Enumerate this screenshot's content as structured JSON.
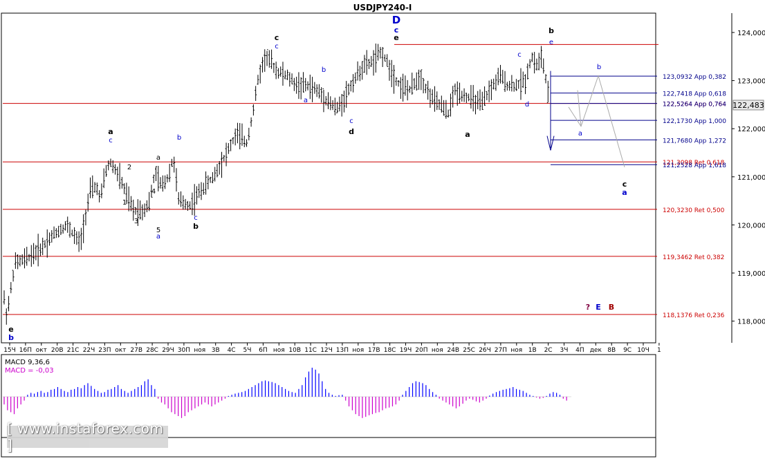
{
  "chart_data": {
    "type": "candlestick",
    "title": "USDJPY240-I",
    "current_price": "122,483",
    "ylim": [
      117.5,
      124.4
    ],
    "y_ticks": [
      "124,000",
      "123,000",
      "122,000",
      "121,000",
      "120,000",
      "119,000",
      "118,000"
    ],
    "y_tick_values": [
      124.0,
      123.0,
      122.0,
      121.0,
      120.0,
      119.0,
      118.0
    ],
    "x_ticks": [
      "15Ч",
      "16П",
      "окт",
      "20В",
      "21С",
      "22Ч",
      "23П",
      "окт",
      "27В",
      "28С",
      "29Ч",
      "30П",
      "ноя",
      "3В",
      "4С",
      "5Ч",
      "6П",
      "ноя",
      "10В",
      "11С",
      "12Ч",
      "13П",
      "ноя",
      "17В",
      "18С",
      "19Ч",
      "20П",
      "ноя",
      "24В",
      "25С",
      "26Ч",
      "27П",
      "ноя",
      "1В",
      "2С",
      "3Ч",
      "4П",
      "дек",
      "8В",
      "9С",
      "10Ч",
      "1"
    ],
    "candle_path_points": [
      [
        0,
        119.0
      ],
      [
        10,
        118.1
      ],
      [
        22,
        119.2
      ],
      [
        40,
        119.3
      ],
      [
        60,
        119.5
      ],
      [
        80,
        119.8
      ],
      [
        100,
        120.0
      ],
      [
        120,
        119.6
      ],
      [
        135,
        120.7
      ],
      [
        145,
        120.8
      ],
      [
        150,
        120.5
      ],
      [
        158,
        121.1
      ],
      [
        165,
        121.3
      ],
      [
        175,
        121.1
      ],
      [
        182,
        120.9
      ],
      [
        190,
        120.6
      ],
      [
        200,
        120.3
      ],
      [
        215,
        120.3
      ],
      [
        225,
        120.5
      ],
      [
        232,
        121.1
      ],
      [
        242,
        120.8
      ],
      [
        252,
        121.0
      ],
      [
        260,
        121.4
      ],
      [
        268,
        120.5
      ],
      [
        285,
        120.4
      ],
      [
        300,
        120.7
      ],
      [
        320,
        121.0
      ],
      [
        340,
        121.5
      ],
      [
        355,
        121.9
      ],
      [
        370,
        121.7
      ],
      [
        380,
        122.4
      ],
      [
        388,
        123.1
      ],
      [
        398,
        123.5
      ],
      [
        406,
        123.4
      ],
      [
        415,
        123.2
      ],
      [
        430,
        123.1
      ],
      [
        445,
        122.9
      ],
      [
        460,
        122.9
      ],
      [
        475,
        122.8
      ],
      [
        490,
        122.6
      ],
      [
        505,
        122.4
      ],
      [
        515,
        122.6
      ],
      [
        530,
        123.0
      ],
      [
        545,
        123.3
      ],
      [
        560,
        123.4
      ],
      [
        572,
        123.6
      ],
      [
        580,
        123.4
      ],
      [
        590,
        123.1
      ],
      [
        600,
        122.9
      ],
      [
        615,
        122.8
      ],
      [
        630,
        123.1
      ],
      [
        640,
        122.8
      ],
      [
        650,
        122.6
      ],
      [
        660,
        122.5
      ],
      [
        672,
        122.3
      ],
      [
        682,
        122.8
      ],
      [
        695,
        122.7
      ],
      [
        710,
        122.6
      ],
      [
        722,
        122.5
      ],
      [
        735,
        122.8
      ],
      [
        750,
        123.1
      ],
      [
        762,
        122.9
      ],
      [
        775,
        122.9
      ],
      [
        788,
        123.0
      ],
      [
        797,
        123.5
      ],
      [
        806,
        123.3
      ],
      [
        812,
        123.5
      ],
      [
        818,
        123.1
      ],
      [
        824,
        122.5
      ]
    ],
    "macd_label": "MACD 9,36,6",
    "macd_value_label": "MACD = -0,03",
    "macd_values": [
      -0.02,
      -0.035,
      -0.04,
      -0.045,
      -0.03,
      -0.02,
      -0.01,
      0.005,
      0.01,
      0.008,
      0.012,
      0.015,
      0.01,
      0.012,
      0.018,
      0.02,
      0.025,
      0.02,
      0.015,
      0.012,
      0.018,
      0.02,
      0.025,
      0.022,
      0.03,
      0.035,
      0.028,
      0.02,
      0.015,
      0.01,
      0.012,
      0.018,
      0.02,
      0.025,
      0.03,
      0.02,
      0.015,
      0.01,
      0.015,
      0.02,
      0.025,
      0.03,
      0.04,
      0.045,
      0.03,
      0.02,
      -0.005,
      -0.015,
      -0.02,
      -0.03,
      -0.04,
      -0.045,
      -0.05,
      -0.055,
      -0.05,
      -0.04,
      -0.035,
      -0.03,
      -0.025,
      -0.02,
      -0.015,
      -0.02,
      -0.025,
      -0.02,
      -0.015,
      -0.01,
      -0.005,
      0.002,
      0.005,
      0.008,
      0.01,
      0.012,
      0.015,
      0.02,
      0.025,
      0.03,
      0.035,
      0.04,
      0.042,
      0.04,
      0.038,
      0.035,
      0.03,
      0.025,
      0.02,
      0.015,
      0.012,
      0.01,
      0.02,
      0.03,
      0.05,
      0.065,
      0.075,
      0.07,
      0.06,
      0.04,
      0.02,
      0.01,
      0.005,
      0.002,
      0.004,
      0.005,
      -0.01,
      -0.025,
      -0.035,
      -0.045,
      -0.05,
      -0.055,
      -0.052,
      -0.048,
      -0.045,
      -0.042,
      -0.04,
      -0.035,
      -0.03,
      -0.028,
      -0.025,
      -0.02,
      -0.01,
      0.005,
      0.015,
      0.025,
      0.035,
      0.04,
      0.038,
      0.035,
      0.03,
      0.02,
      0.012,
      0.005,
      -0.005,
      -0.01,
      -0.015,
      -0.02,
      -0.025,
      -0.03,
      -0.025,
      -0.018,
      -0.01,
      -0.005,
      -0.008,
      -0.012,
      -0.015,
      -0.01,
      -0.005,
      0.003,
      0.008,
      0.012,
      0.015,
      0.018,
      0.02,
      0.022,
      0.025,
      0.02,
      0.018,
      0.015,
      0.01,
      0.005,
      0.002,
      -0.002,
      -0.005,
      -0.003,
      0.002,
      0.008,
      0.012,
      0.01,
      0.005,
      -0.005,
      -0.01
    ],
    "levels_red": [
      {
        "price": 123.75,
        "label": ""
      },
      {
        "price": 122.5264,
        "label": "122,5264 App 0,764"
      },
      {
        "price": 121.3098,
        "label": "121,3098 Ret 0,618"
      },
      {
        "price": 120.323,
        "label": "120,3230 Ret 0,500"
      },
      {
        "price": 119.3462,
        "label": "119,3462 Ret 0,382"
      },
      {
        "price": 118.1376,
        "label": "118,1376 Ret 0,236"
      }
    ],
    "levels_blue": [
      {
        "price": 123.0932,
        "label": "123,0932 App 0,382"
      },
      {
        "price": 122.7418,
        "label": "122,7418 App 0,618"
      },
      {
        "price": 122.5264,
        "label": "122,5264 App 0,764"
      },
      {
        "price": 122.173,
        "label": "122,1730 App 1,000"
      },
      {
        "price": 121.768,
        "label": "121,7680 App 1,272"
      },
      {
        "price": 121.2528,
        "label": "121,2528 App 1,618"
      }
    ],
    "wave_labels": [
      {
        "text": "D",
        "color": "#0000cc",
        "bold": true
      },
      {
        "text": "c",
        "color": "#0000cc",
        "bold": true
      },
      {
        "text": "e",
        "color": "#000000",
        "bold": true
      },
      {
        "text": "b",
        "color": "#000000",
        "bold": true
      },
      {
        "text": "e",
        "color": "#0000cc",
        "bold": false
      },
      {
        "text": "c",
        "color": "#000000",
        "bold": true
      },
      {
        "text": "c",
        "color": "#0000cc",
        "bold": false
      },
      {
        "text": "a",
        "color": "#000000",
        "bold": true
      },
      {
        "text": "c",
        "color": "#0000cc",
        "bold": false
      },
      {
        "text": "b",
        "color": "#0000cc",
        "bold": false
      },
      {
        "text": "a",
        "color": "#000000",
        "bold": false
      },
      {
        "text": "2",
        "color": "#000000",
        "bold": false
      },
      {
        "text": "4",
        "color": "#000000",
        "bold": false
      },
      {
        "text": "1",
        "color": "#000000",
        "bold": false
      },
      {
        "text": "3",
        "color": "#000000",
        "bold": false
      },
      {
        "text": "5",
        "color": "#000000",
        "bold": false
      },
      {
        "text": "a",
        "color": "#0000cc",
        "bold": false
      },
      {
        "text": "c",
        "color": "#0000cc",
        "bold": false
      },
      {
        "text": "b",
        "color": "#000000",
        "bold": true
      },
      {
        "text": "a",
        "color": "#0000cc",
        "bold": false
      },
      {
        "text": "b",
        "color": "#0000cc",
        "bold": false
      },
      {
        "text": "d",
        "color": "#000000",
        "bold": true
      },
      {
        "text": "c",
        "color": "#0000cc",
        "bold": false
      },
      {
        "text": "a",
        "color": "#000000",
        "bold": true
      },
      {
        "text": "e",
        "color": "#000000",
        "bold": true
      },
      {
        "text": "b",
        "color": "#0000cc",
        "bold": true
      },
      {
        "text": "? ",
        "color": "#800040",
        "bold": true
      },
      {
        "text": "E",
        "color": "#0000cc",
        "bold": true
      },
      {
        "text": "B",
        "color": "#a00000",
        "bold": true
      },
      {
        "text": "c",
        "color": "#000000",
        "bold": true
      },
      {
        "text": "a",
        "color": "#0000cc",
        "bold": true
      },
      {
        "text": "b",
        "color": "#0000cc",
        "bold": false
      },
      {
        "text": "a",
        "color": "#0000cc",
        "bold": false
      },
      {
        "text": "c",
        "color": "#0000cc",
        "bold": false
      },
      {
        "text": "d",
        "color": "#0000cc",
        "bold": false
      }
    ],
    "colors": {
      "resistance": "#cc0000",
      "projection": "#00008b",
      "bars": "#000000",
      "macd_pos": "#0000ff",
      "macd_neg": "#cc00cc",
      "price_tag": "#e8e8e8"
    }
  },
  "watermark": "[ www.instaforex.com ]"
}
